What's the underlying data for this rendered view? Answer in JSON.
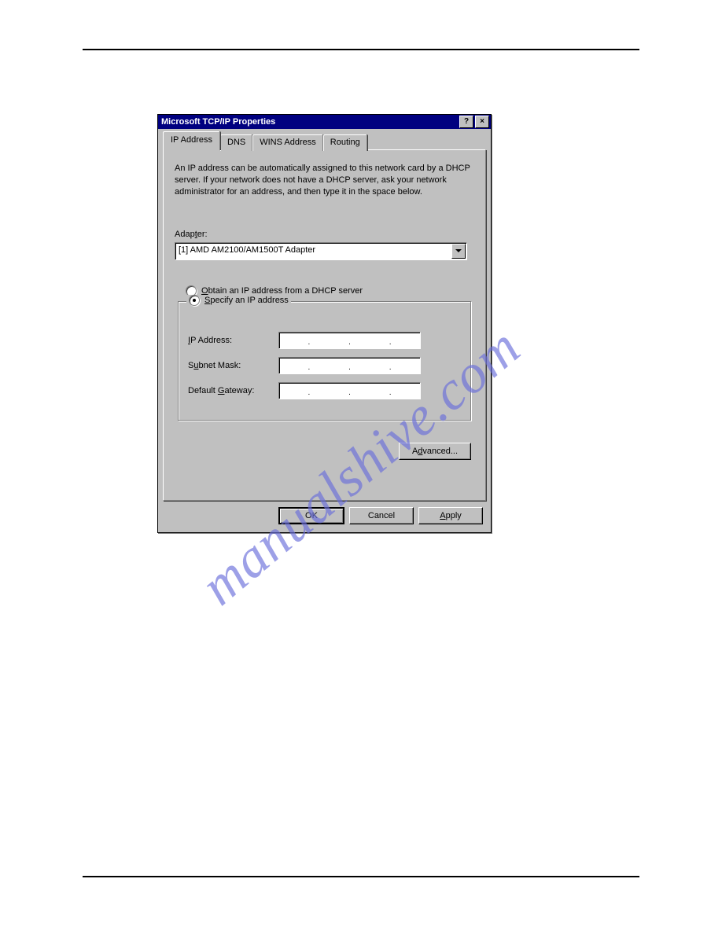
{
  "watermark": "manualshive.com",
  "dialog": {
    "title": "Microsoft TCP/IP Properties",
    "help_icon": "?",
    "close_icon": "×",
    "tabs": [
      "IP Address",
      "DNS",
      "WINS Address",
      "Routing"
    ],
    "active_tab": 0,
    "intro": "An IP address can be automatically assigned to this network card by a DHCP server. If your network does not have a DHCP server, ask your network administrator for an address, and then type it in the space below.",
    "adapter": {
      "label_pre": "Adap",
      "label_u": "t",
      "label_post": "er:",
      "value": "[1] AMD AM2100/AM1500T Adapter"
    },
    "radio1": {
      "u": "O",
      "rest": "btain an IP address from a DHCP server",
      "checked": false
    },
    "radio2": {
      "u": "S",
      "rest": "pecify an IP address",
      "checked": true
    },
    "fields": {
      "ip": {
        "label_pre": "",
        "u": "I",
        "label_post": "P Address:",
        "value": ""
      },
      "subnet": {
        "label_pre": "S",
        "u": "u",
        "label_post": "bnet Mask:",
        "value": ""
      },
      "gateway": {
        "label_pre": "Default ",
        "u": "G",
        "label_post": "ateway:",
        "value": ""
      }
    },
    "buttons": {
      "advanced_pre": "A",
      "advanced_u": "d",
      "advanced_post": "vanced...",
      "ok": "OK",
      "cancel": "Cancel",
      "apply_u": "A",
      "apply_post": "pply"
    }
  }
}
